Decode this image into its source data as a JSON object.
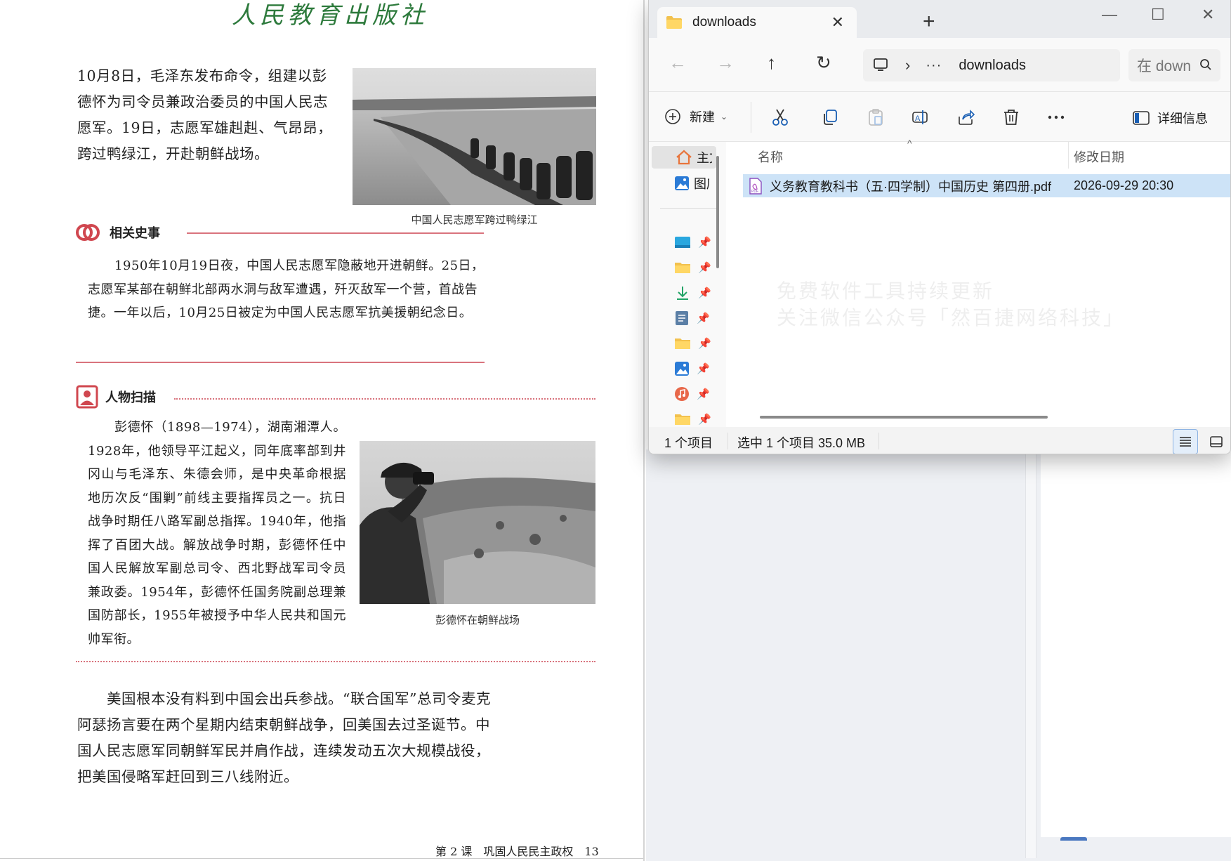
{
  "pdf": {
    "publisher": "人民教育出版社",
    "intro": "10月8日，毛泽东发布命令，组建以彭德怀为司令员兼政治委员的中国人民志愿军。19日，志愿军雄赳赳、气昂昂，跨过鸭绿江，开赴朝鲜战场。",
    "photo1_caption": "中国人民志愿军跨过鸭绿江",
    "related_history": {
      "title": "相关史事",
      "text": "1950年10月19日夜，中国人民志愿军隐蔽地开进朝鲜。25日，志愿军某部在朝鲜北部两水洞与敌军遭遇，歼灭敌军一个营，首战告捷。一年以后，10月25日被定为中国人民志愿军抗美援朝纪念日。"
    },
    "person_scan": {
      "title": "人物扫描",
      "text": "彭德怀（1898—1974），湖南湘潭人。1928年，他领导平江起义，同年底率部到井冈山与毛泽东、朱德会师，是中央革命根据地历次反“围剿”前线主要指挥员之一。抗日战争时期任八路军副总指挥。1940年，他指挥了百团大战。解放战争时期，彭德怀任中国人民解放军副总司令、西北野战军司令员兼政委。1954年，彭德怀任国务院副总理兼国防部长，1955年被授予中华人民共和国元帅军衔。"
    },
    "photo2_caption": "彭德怀在朝鲜战场",
    "closing": "美国根本没有料到中国会出兵参战。“联合国军”总司令麦克阿瑟扬言要在两个星期内结束朝鲜战争，回美国去过圣诞节。中国人民志愿军同朝鲜军民并肩作战，连续发动五次大规模战役，把美国侵略军赶回到三八线附近。",
    "footer": "第 2 课　巩固人民民主政权　13"
  },
  "explorer": {
    "tab_title": "downloads",
    "address": {
      "more": "···",
      "current": "downloads"
    },
    "search_placeholder": "在 downloads 中搜索",
    "commands": {
      "new_label": "新建",
      "details_label": "详细信息"
    },
    "nav": {
      "home_label": "主文件夹",
      "gallery_label": "图库",
      "pinned_icons": [
        "desktop-icon",
        "folder-icon",
        "download-icon",
        "documents-icon",
        "folder-icon",
        "pictures-icon",
        "music-icon",
        "folder-icon"
      ]
    },
    "columns": {
      "name": "名称",
      "date": "修改日期"
    },
    "files": [
      {
        "name": "义务教育教科书（五·四学制）中国历史 第四册.pdf",
        "modified": "2026-09-29 20:30",
        "icon": "pdf-file-icon"
      }
    ],
    "watermark": {
      "line1": "免费软件工具持续更新",
      "line2": "关注微信公众号「然百捷网络科技」"
    },
    "status": {
      "count": "1 个项目",
      "selection": "选中 1 个项目  35.0 MB"
    }
  }
}
